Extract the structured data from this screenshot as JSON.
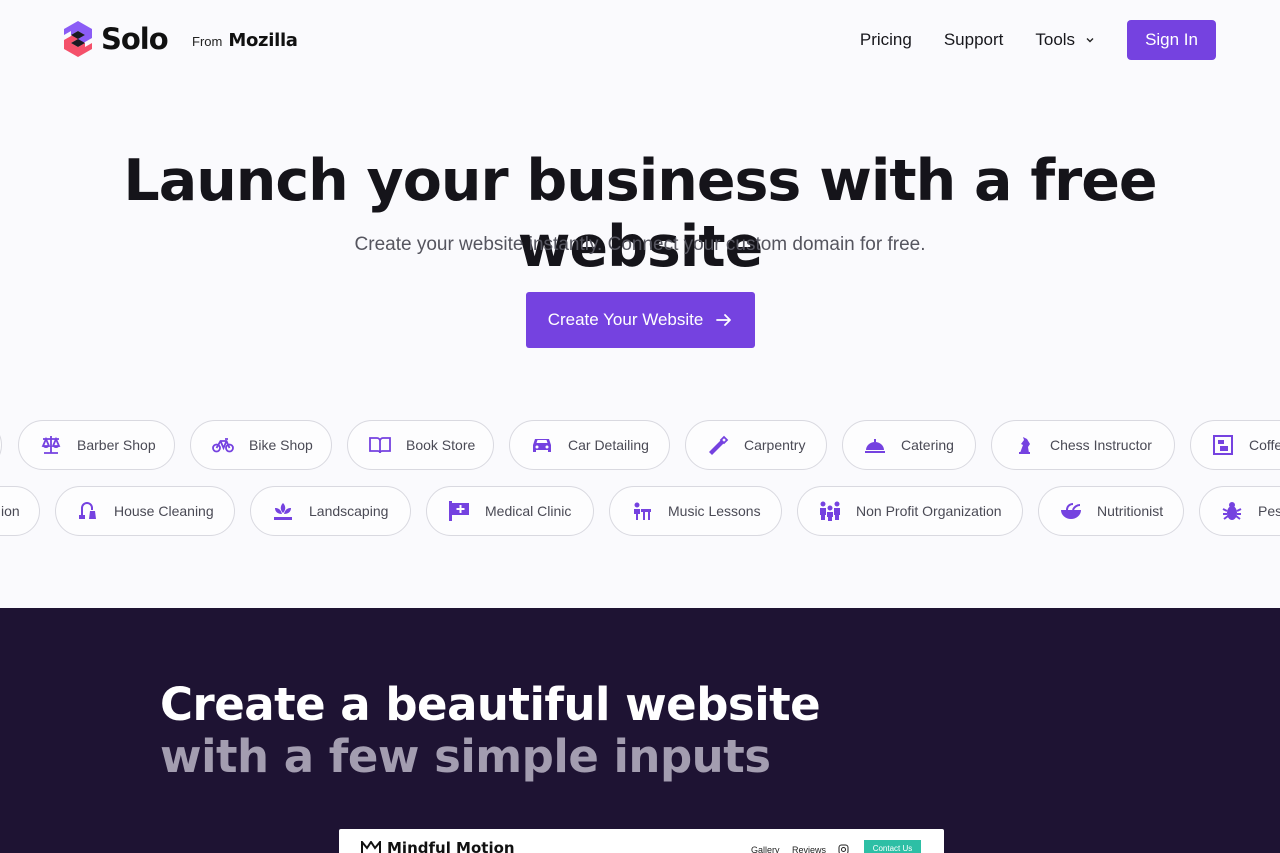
{
  "header": {
    "logo_text": "Solo",
    "from_label": "From",
    "from_brand": "Mozilla",
    "nav": [
      {
        "label": "Pricing"
      },
      {
        "label": "Support"
      },
      {
        "label": "Tools"
      }
    ],
    "signin_label": "Sign In"
  },
  "hero": {
    "title": "Launch your business with a free website",
    "subtitle": "Create your website instantly. Connect your custom domain for free.",
    "cta_label": "Create Your Website"
  },
  "business_types": {
    "row1": [
      {
        "label": "",
        "icon": "circle-icon"
      },
      {
        "label": "Barber Shop",
        "icon": "scales-icon"
      },
      {
        "label": "Bike Shop",
        "icon": "bicycle-icon"
      },
      {
        "label": "Book Store",
        "icon": "book-icon"
      },
      {
        "label": "Car Detailing",
        "icon": "car-icon"
      },
      {
        "label": "Carpentry",
        "icon": "saw-icon"
      },
      {
        "label": "Catering",
        "icon": "cloche-icon"
      },
      {
        "label": "Chess Instructor",
        "icon": "chess-knight-icon"
      },
      {
        "label": "Coffe",
        "icon": "coffee-icon"
      }
    ],
    "row2": [
      {
        "label": "ion",
        "icon": ""
      },
      {
        "label": "House Cleaning",
        "icon": "vacuum-icon"
      },
      {
        "label": "Landscaping",
        "icon": "plant-icon"
      },
      {
        "label": "Medical Clinic",
        "icon": "medical-cross-icon"
      },
      {
        "label": "Music Lessons",
        "icon": "music-icon"
      },
      {
        "label": "Non Profit Organization",
        "icon": "people-icon"
      },
      {
        "label": "Nutritionist",
        "icon": "bowl-icon"
      },
      {
        "label": "Pes",
        "icon": "bug-icon"
      }
    ]
  },
  "feature": {
    "heading_line1": "Create a beautiful website",
    "heading_line2": "with a few simple inputs"
  },
  "preview": {
    "brand": "Mindful Motion",
    "links": [
      "Gallery",
      "Reviews"
    ],
    "contact_label": "Contact Us"
  },
  "colors": {
    "accent": "#7542e0",
    "dark_bg": "#1e1333",
    "teal": "#2dbfa5"
  }
}
